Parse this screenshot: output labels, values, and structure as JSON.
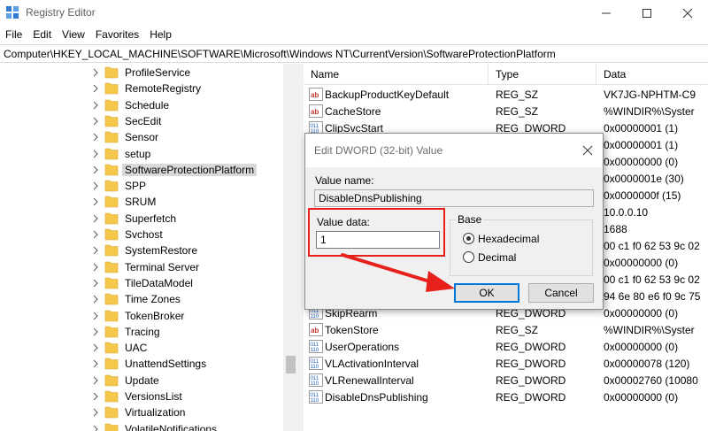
{
  "window": {
    "title": "Registry Editor"
  },
  "menu": [
    "File",
    "Edit",
    "View",
    "Favorites",
    "Help"
  ],
  "address": "Computer\\HKEY_LOCAL_MACHINE\\SOFTWARE\\Microsoft\\Windows NT\\CurrentVersion\\SoftwareProtectionPlatform",
  "tree": {
    "items": [
      {
        "label": "ProfileService"
      },
      {
        "label": "RemoteRegistry"
      },
      {
        "label": "Schedule"
      },
      {
        "label": "SecEdit"
      },
      {
        "label": "Sensor"
      },
      {
        "label": "setup"
      },
      {
        "label": "SoftwareProtectionPlatform",
        "selected": true
      },
      {
        "label": "SPP"
      },
      {
        "label": "SRUM"
      },
      {
        "label": "Superfetch"
      },
      {
        "label": "Svchost"
      },
      {
        "label": "SystemRestore"
      },
      {
        "label": "Terminal Server"
      },
      {
        "label": "TileDataModel"
      },
      {
        "label": "Time Zones"
      },
      {
        "label": "TokenBroker"
      },
      {
        "label": "Tracing"
      },
      {
        "label": "UAC"
      },
      {
        "label": "UnattendSettings"
      },
      {
        "label": "Update"
      },
      {
        "label": "VersionsList"
      },
      {
        "label": "Virtualization"
      },
      {
        "label": "VolatileNotifications"
      }
    ]
  },
  "list": {
    "columns": [
      "Name",
      "Type",
      "Data"
    ],
    "rows": [
      {
        "name": "BackupProductKeyDefault",
        "type": "REG_SZ",
        "data": "VK7JG-NPHTM-C9",
        "icon": "string-value-icon"
      },
      {
        "name": "CacheStore",
        "type": "REG_SZ",
        "data": "%WINDIR%\\Syster",
        "icon": "string-value-icon"
      },
      {
        "name": "ClipSvcStart",
        "type": "REG_DWORD",
        "data": "0x00000001 (1)",
        "icon": "binary-value-icon"
      },
      {
        "name": "",
        "type": "",
        "data": "0x00000001 (1)",
        "icon": ""
      },
      {
        "name": "",
        "type": "",
        "data": "0x00000000 (0)",
        "icon": ""
      },
      {
        "name": "",
        "type": "",
        "data": "0x0000001e (30)",
        "icon": ""
      },
      {
        "name": "",
        "type": "",
        "data": "0x0000000f (15)",
        "icon": ""
      },
      {
        "name": "",
        "type": "",
        "data": "10.0.0.10",
        "icon": ""
      },
      {
        "name": "",
        "type": "",
        "data": "1688",
        "icon": ""
      },
      {
        "name": "",
        "type": "",
        "data": "00 c1 f0 62 53 9c 02",
        "icon": ""
      },
      {
        "name": "",
        "type": "",
        "data": "0x00000000 (0)",
        "icon": ""
      },
      {
        "name": "",
        "type": "",
        "data": "00 c1 f0 62 53 9c 02",
        "icon": ""
      },
      {
        "name": "",
        "type": "",
        "data": "94 6e 80 e6 f0 9c 75",
        "icon": ""
      },
      {
        "name": "SkipRearm",
        "type": "REG_DWORD",
        "data": "0x00000000 (0)",
        "icon": "binary-value-icon"
      },
      {
        "name": "TokenStore",
        "type": "REG_SZ",
        "data": "%WINDIR%\\Syster",
        "icon": "string-value-icon"
      },
      {
        "name": "UserOperations",
        "type": "REG_DWORD",
        "data": "0x00000000 (0)",
        "icon": "binary-value-icon"
      },
      {
        "name": "VLActivationInterval",
        "type": "REG_DWORD",
        "data": "0x00000078 (120)",
        "icon": "binary-value-icon"
      },
      {
        "name": "VLRenewalInterval",
        "type": "REG_DWORD",
        "data": "0x00002760 (10080",
        "icon": "binary-value-icon"
      },
      {
        "name": "DisableDnsPublishing",
        "type": "REG_DWORD",
        "data": "0x00000000 (0)",
        "icon": "binary-value-icon"
      }
    ]
  },
  "dialog": {
    "title": "Edit DWORD (32-bit) Value",
    "value_name_label": "Value name:",
    "value_name": "DisableDnsPublishing",
    "value_data_label": "Value data:",
    "value_data": "1",
    "base_label": "Base",
    "base_options": [
      "Hexadecimal",
      "Decimal"
    ],
    "base_selected": "Hexadecimal",
    "ok_label": "OK",
    "cancel_label": "Cancel"
  },
  "colors": {
    "highlight": "#e8201b",
    "selection": "#d9d9d9",
    "default_button_border": "#0078d7",
    "folder": "#f5c84c"
  }
}
